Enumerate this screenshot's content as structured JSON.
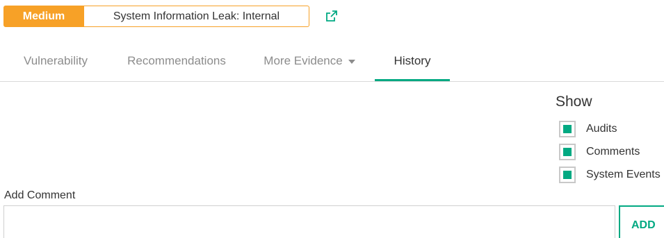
{
  "header": {
    "severity": "Medium",
    "title": "System Information Leak: Internal",
    "accent_color": "#f7a127",
    "external_link_icon": "external-link-icon"
  },
  "tabs": [
    {
      "label": "Vulnerability",
      "active": false
    },
    {
      "label": "Recommendations",
      "active": false
    },
    {
      "label": "More Evidence",
      "active": false,
      "has_dropdown": true
    },
    {
      "label": "History",
      "active": true
    }
  ],
  "tab_active_color": "#01a982",
  "show": {
    "title": "Show",
    "filters": [
      {
        "label": "Audits",
        "checked": true
      },
      {
        "label": "Comments",
        "checked": true
      },
      {
        "label": "System Events",
        "checked": true
      }
    ]
  },
  "comment": {
    "label": "Add Comment",
    "value": "",
    "placeholder": "",
    "add_label": "ADD"
  }
}
